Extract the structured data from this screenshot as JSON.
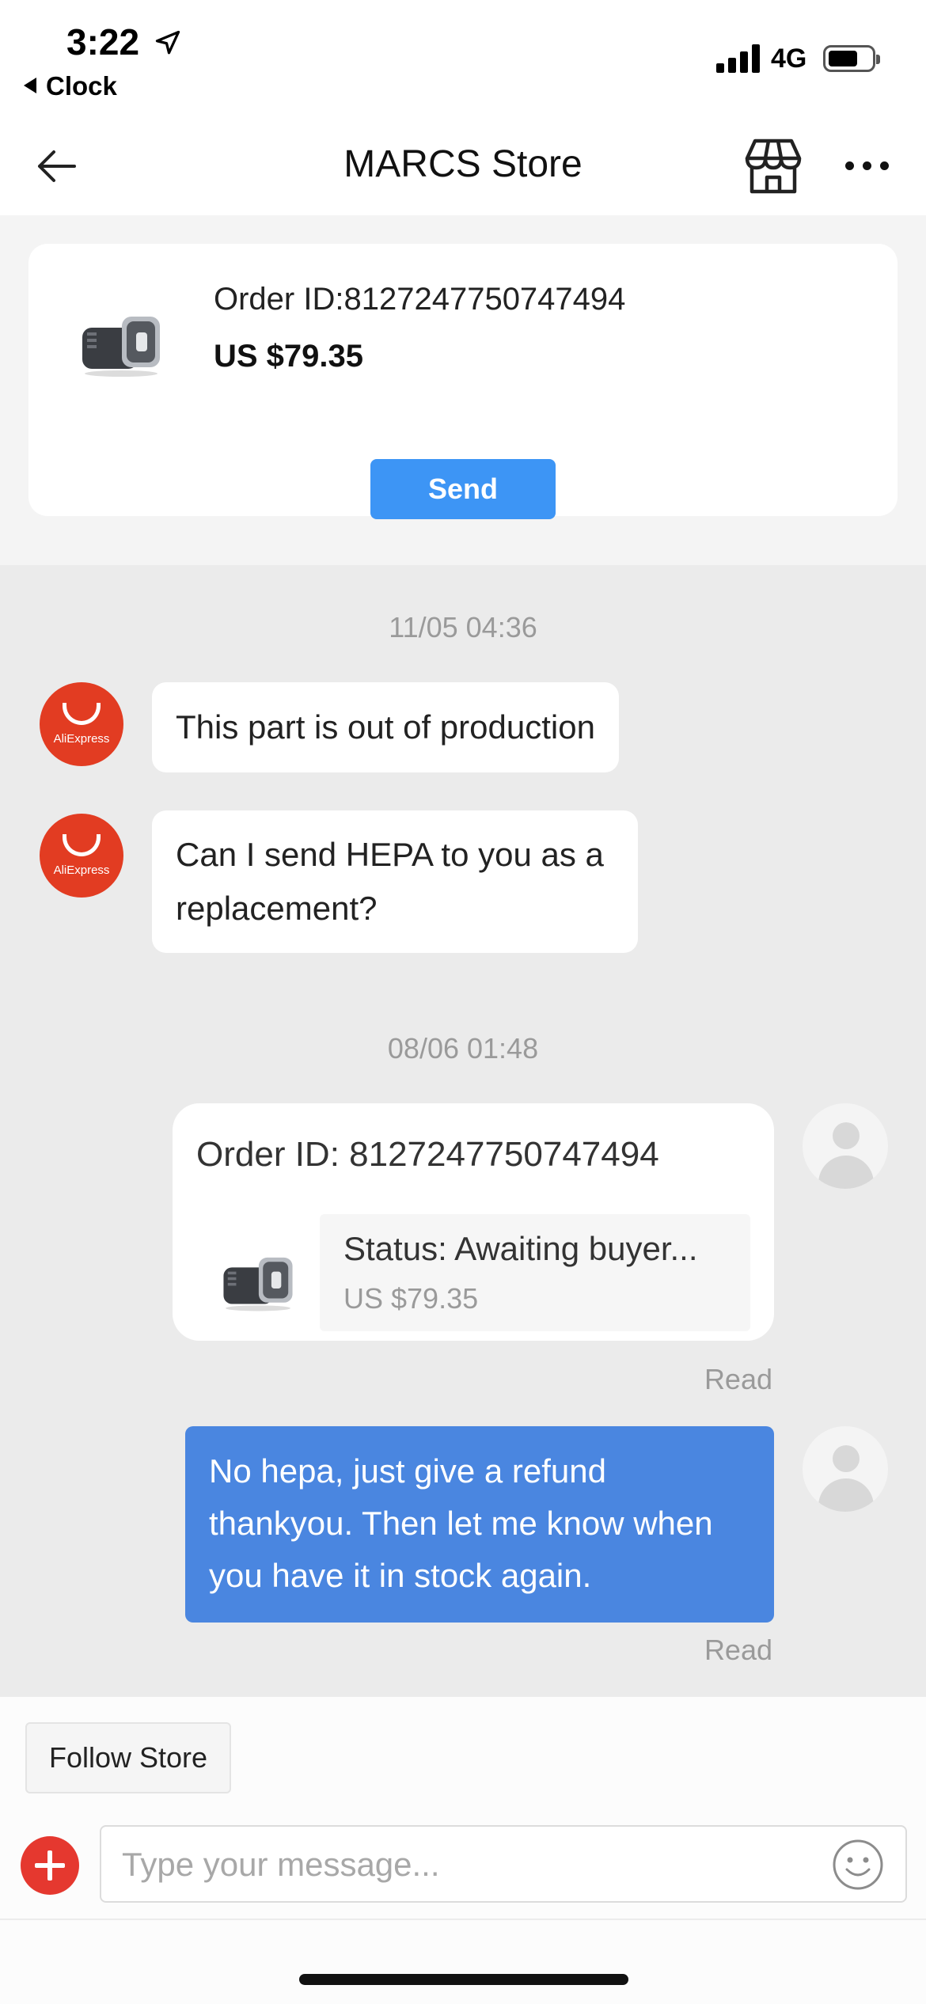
{
  "status_bar": {
    "time": "3:22",
    "back_app": "Clock",
    "network": "4G"
  },
  "nav": {
    "title": "MARCS Store",
    "icons": [
      "back-arrow-icon",
      "store-icon",
      "more-icon"
    ]
  },
  "order_card": {
    "order_id": "Order ID:8127247750747494",
    "price": "US $79.35",
    "send_label": "Send"
  },
  "messages": [
    {
      "type": "timestamp",
      "text": "11/05 04:36"
    },
    {
      "type": "incoming",
      "avatar_label": "AliExpress",
      "text": "This part is out of production"
    },
    {
      "type": "incoming",
      "avatar_label": "AliExpress",
      "lines": [
        "Can I send HEPA to you as a",
        "replacement?"
      ]
    },
    {
      "type": "timestamp",
      "text": "08/06 01:48"
    },
    {
      "type": "order",
      "order_id": "Order ID: 8127247750747494",
      "status": "Status:  Awaiting buyer...",
      "price": "US $79.35",
      "read": "Read"
    },
    {
      "type": "outgoing",
      "lines": [
        "No hepa, just give a refund",
        "thankyou. Then let me know when",
        "you have it in stock again."
      ],
      "read": "Read"
    }
  ],
  "bottom": {
    "follow_label": "Follow Store",
    "input_placeholder": "Type your message...",
    "input_value": ""
  },
  "colors": {
    "accent_blue": "#3d95f5",
    "outgoing_bubble": "#4a86e0",
    "aliexpress_red": "#e23c22",
    "plus_red": "#e5382f",
    "chat_bg": "#ebebeb"
  }
}
